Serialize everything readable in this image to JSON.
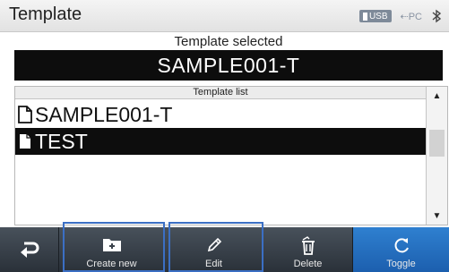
{
  "app": {
    "title": "Template"
  },
  "status": {
    "usb_label": "USB",
    "pc_label": "PC",
    "bluetooth_icon": "bluetooth-icon"
  },
  "selected": {
    "label": "Template selected",
    "value": "SAMPLE001-T"
  },
  "template_list": {
    "header": "Template list",
    "items": [
      {
        "name": "SAMPLE001-T",
        "icon": "file-outline-icon",
        "selected": false
      },
      {
        "name": "TEST",
        "icon": "file-filled-icon",
        "selected": true
      }
    ]
  },
  "toolbar": {
    "back_icon": "return-icon",
    "create_label": "Create new",
    "edit_label": "Edit",
    "delete_label": "Delete",
    "toggle_label": "Toggle"
  },
  "colors": {
    "toggle_accent": "#1c5fae",
    "selection_bg": "#0d0d0d",
    "focus_outline": "#3b6fc4"
  }
}
